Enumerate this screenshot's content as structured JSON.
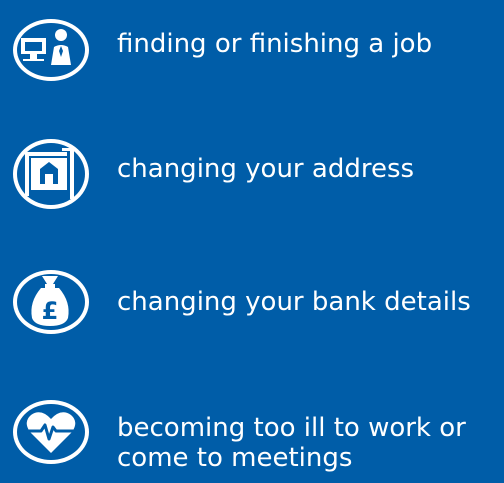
{
  "colors": {
    "background": "#005da8",
    "icon_blue": "#005da8",
    "icon_white": "#ffffff",
    "text": "#ffffff"
  },
  "items": [
    {
      "icon": "job-computer-person-icon",
      "label": "finding or finishing a job"
    },
    {
      "icon": "house-address-icon",
      "label": "changing your address"
    },
    {
      "icon": "money-bag-pound-icon",
      "label": "changing your bank details"
    },
    {
      "icon": "heart-heartbeat-icon",
      "label_line1": "becoming too ill to work or",
      "label_line2": "come to meetings"
    }
  ]
}
